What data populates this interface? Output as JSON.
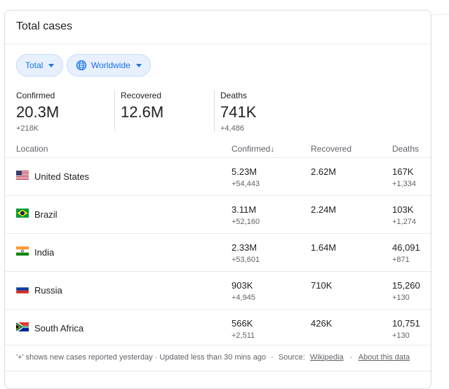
{
  "card": {
    "title": "Total cases"
  },
  "filters": {
    "total_label": "Total",
    "region_label": "Worldwide"
  },
  "summary": {
    "confirmed": {
      "label": "Confirmed",
      "value": "20.3M",
      "delta": "+218K"
    },
    "recovered": {
      "label": "Recovered",
      "value": "12.6M"
    },
    "deaths": {
      "label": "Deaths",
      "value": "741K",
      "delta": "+4,486"
    }
  },
  "table": {
    "headers": {
      "location": "Location",
      "confirmed": "Confirmed↓",
      "recovered": "Recovered",
      "deaths": "Deaths"
    },
    "rows": [
      {
        "country": "United States",
        "flag": "us-flag-icon",
        "confirmed": "5.23M",
        "confirmed_delta": "+54,443",
        "recovered": "2.62M",
        "deaths": "167K",
        "deaths_delta": "+1,334"
      },
      {
        "country": "Brazil",
        "flag": "brazil-flag-icon",
        "confirmed": "3.11M",
        "confirmed_delta": "+52,160",
        "recovered": "2.24M",
        "deaths": "103K",
        "deaths_delta": "+1,274"
      },
      {
        "country": "India",
        "flag": "india-flag-icon",
        "confirmed": "2.33M",
        "confirmed_delta": "+53,601",
        "recovered": "1.64M",
        "deaths": "46,091",
        "deaths_delta": "+871"
      },
      {
        "country": "Russia",
        "flag": "russia-flag-icon",
        "confirmed": "903K",
        "confirmed_delta": "+4,945",
        "recovered": "710K",
        "deaths": "15,260",
        "deaths_delta": "+130"
      },
      {
        "country": "South Africa",
        "flag": "south-africa-flag-icon",
        "confirmed": "566K",
        "confirmed_delta": "+2,511",
        "recovered": "426K",
        "deaths": "10,751",
        "deaths_delta": "+130"
      }
    ]
  },
  "footer": {
    "note": "'+' shows new cases reported yesterday · Updated less than 30 mins ago",
    "sep1": "·",
    "source_label": "Source:",
    "source_link": "Wikipedia",
    "sep2": "·",
    "about_link": "About this data"
  },
  "colors": {
    "accent": "#1a73e8",
    "chip_bg": "#e8f0fe",
    "muted": "#5f6368"
  }
}
